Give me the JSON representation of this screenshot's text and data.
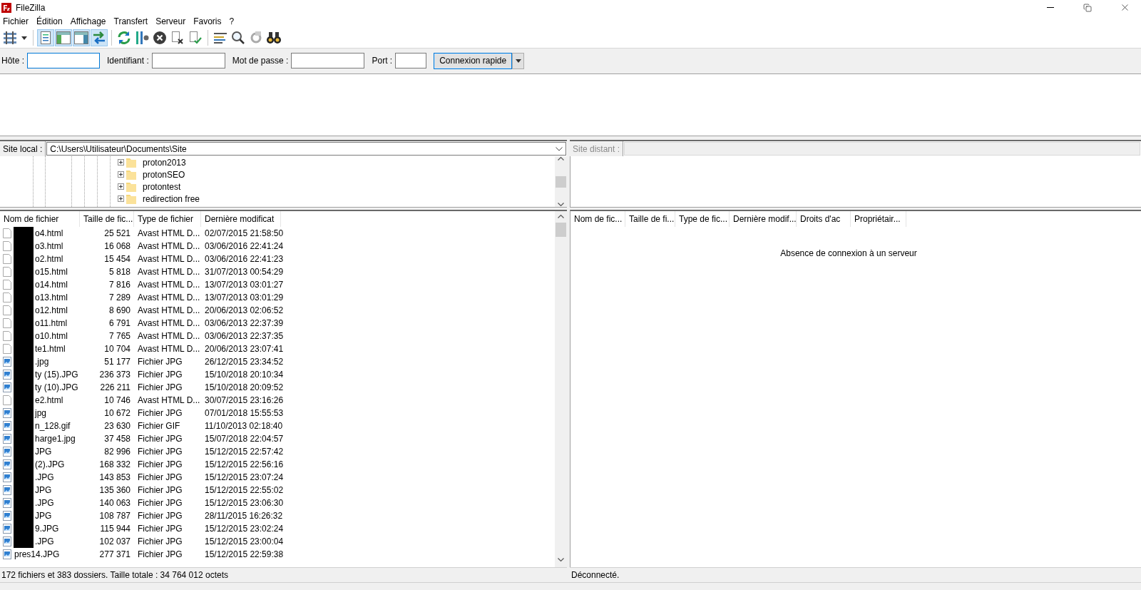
{
  "window": {
    "title": "FileZilla"
  },
  "menu": [
    "Fichier",
    "Édition",
    "Affichage",
    "Transfert",
    "Serveur",
    "Favoris",
    "?"
  ],
  "toolbar": [
    {
      "kind": "sitemanager",
      "pressed": false
    },
    {
      "kind": "log",
      "pressed": true
    },
    {
      "kind": "localtree",
      "pressed": true
    },
    {
      "kind": "remotetree",
      "pressed": true
    },
    {
      "kind": "queue",
      "pressed": true
    },
    {
      "kind": "refresh",
      "pressed": false
    },
    {
      "kind": "filter",
      "pressed": false
    },
    {
      "kind": "cancel",
      "pressed": false
    },
    {
      "kind": "disconnect",
      "pressed": false
    },
    {
      "kind": "reconnect",
      "pressed": false
    },
    {
      "kind": "list",
      "pressed": false
    },
    {
      "kind": "search",
      "pressed": false
    },
    {
      "kind": "sync",
      "pressed": false
    },
    {
      "kind": "binoculars",
      "pressed": false
    }
  ],
  "quickconnect": {
    "fields": [
      {
        "label": "Hôte :",
        "focused": true
      },
      {
        "label": "Identifiant :",
        "focused": false
      },
      {
        "label": "Mot de passe :",
        "focused": false
      },
      {
        "label": "Port :",
        "focused": false
      }
    ],
    "button": "Connexion rapide"
  },
  "local": {
    "site_label": "Site local :",
    "path": "C:\\Users\\Utilisateur\\Documents\\Site",
    "tree": [
      {
        "name": "proton2013",
        "expanded": false
      },
      {
        "name": "protonSEO",
        "expanded": false
      },
      {
        "name": "protontest",
        "expanded": false
      },
      {
        "name": "redirection free",
        "expanded": false
      }
    ],
    "columns": [
      "Nom de fichier",
      "Taille de fic...",
      "Type de fichier",
      "Dernière modificat"
    ],
    "rows": [
      {
        "kind": "html",
        "name": "o4.html",
        "size": "25 521",
        "type": "Avast HTML D...",
        "modified": "02/07/2015 21:58:50"
      },
      {
        "kind": "html",
        "name": "o3.html",
        "size": "16 068",
        "type": "Avast HTML D...",
        "modified": "03/06/2016 22:41:24"
      },
      {
        "kind": "html",
        "name": "o2.html",
        "size": "15 454",
        "type": "Avast HTML D...",
        "modified": "03/06/2016 22:41:23"
      },
      {
        "kind": "html",
        "name": "o15.html",
        "size": "5 818",
        "type": "Avast HTML D...",
        "modified": "31/07/2013 00:54:29"
      },
      {
        "kind": "html",
        "name": "o14.html",
        "size": "7 816",
        "type": "Avast HTML D...",
        "modified": "13/07/2013 03:01:27"
      },
      {
        "kind": "html",
        "name": "o13.html",
        "size": "7 289",
        "type": "Avast HTML D...",
        "modified": "13/07/2013 03:01:29"
      },
      {
        "kind": "html",
        "name": "o12.html",
        "size": "8 690",
        "type": "Avast HTML D...",
        "modified": "20/06/2013 02:06:52"
      },
      {
        "kind": "html",
        "name": "o11.html",
        "size": "6 791",
        "type": "Avast HTML D...",
        "modified": "03/06/2013 22:37:39"
      },
      {
        "kind": "html",
        "name": "o10.html",
        "size": "7 765",
        "type": "Avast HTML D...",
        "modified": "03/06/2013 22:37:35"
      },
      {
        "kind": "html",
        "name": "te1.html",
        "size": "10 704",
        "type": "Avast HTML D...",
        "modified": "20/06/2013 23:07:41"
      },
      {
        "kind": "image",
        "name": ".jpg",
        "size": "51 177",
        "type": "Fichier JPG",
        "modified": "26/12/2015 23:34:52"
      },
      {
        "kind": "image",
        "name": "ty (15).JPG",
        "size": "236 373",
        "type": "Fichier JPG",
        "modified": "15/10/2018 20:10:34"
      },
      {
        "kind": "image",
        "name": "ty (10).JPG",
        "size": "226 211",
        "type": "Fichier JPG",
        "modified": "15/10/2018 20:09:52"
      },
      {
        "kind": "html",
        "name": "e2.html",
        "size": "10 746",
        "type": "Avast HTML D...",
        "modified": "30/07/2015 23:16:26"
      },
      {
        "kind": "image",
        "name": "jpg",
        "size": "10 672",
        "type": "Fichier JPG",
        "modified": "07/01/2018 15:55:53"
      },
      {
        "kind": "image",
        "name": "n_128.gif",
        "size": "23 630",
        "type": "Fichier GIF",
        "modified": "11/10/2013 02:18:40"
      },
      {
        "kind": "image",
        "name": "harge1.jpg",
        "size": "37 458",
        "type": "Fichier JPG",
        "modified": "15/07/2018 22:04:57"
      },
      {
        "kind": "image",
        "name": "JPG",
        "size": "82 996",
        "type": "Fichier JPG",
        "modified": "15/12/2015 22:57:42"
      },
      {
        "kind": "image",
        "name": "(2).JPG",
        "size": "168 332",
        "type": "Fichier JPG",
        "modified": "15/12/2015 22:56:16"
      },
      {
        "kind": "image",
        "name": ".JPG",
        "size": "143 853",
        "type": "Fichier JPG",
        "modified": "15/12/2015 23:07:24"
      },
      {
        "kind": "image",
        "name": "JPG",
        "size": "135 360",
        "type": "Fichier JPG",
        "modified": "15/12/2015 22:55:02"
      },
      {
        "kind": "image",
        "name": ".JPG",
        "size": "140 063",
        "type": "Fichier JPG",
        "modified": "15/12/2015 23:06:30"
      },
      {
        "kind": "image",
        "name": "JPG",
        "size": "108 787",
        "type": "Fichier JPG",
        "modified": "28/11/2015 16:26:32"
      },
      {
        "kind": "image",
        "name": "9.JPG",
        "size": "115 944",
        "type": "Fichier JPG",
        "modified": "15/12/2015 23:02:24"
      },
      {
        "kind": "image",
        "name": ".JPG",
        "size": "102 037",
        "type": "Fichier JPG",
        "modified": "15/12/2015 23:00:04"
      },
      {
        "kind": "image",
        "name": "pres14.JPG",
        "size": "277 371",
        "type": "Fichier JPG",
        "modified": "15/12/2015 22:59:38"
      }
    ],
    "status": "172 fichiers et 383 dossiers. Taille totale : 34 764 012 octets"
  },
  "remote": {
    "site_label": "Site distant :",
    "columns": [
      "Nom de fic...",
      "Taille de fi...",
      "Type de fic...",
      "Dernière modif...",
      "Droits d'ac",
      "Propriétair..."
    ],
    "message": "Absence de connexion à un serveur",
    "status": "Déconnecté."
  }
}
